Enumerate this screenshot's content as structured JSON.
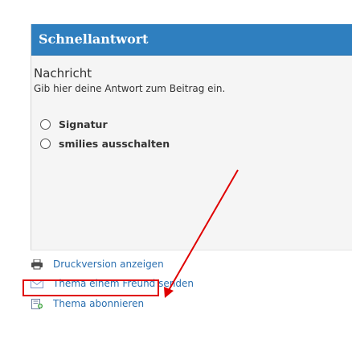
{
  "panel": {
    "title": "Schnellantwort",
    "section_title": "Nachricht",
    "section_desc": "Gib hier deine Antwort zum Beitrag ein.",
    "options": [
      {
        "label": "Signatur"
      },
      {
        "label": "smilies ausschalten"
      }
    ]
  },
  "links": {
    "print_label": "Druckversion anzeigen",
    "email_label": "Thema einem Freund senden",
    "subscribe_label": "Thema abonnieren"
  },
  "colors": {
    "header_bg": "#2f7fbf",
    "link": "#2a6fb0",
    "annotation": "#e00000"
  },
  "icons": {
    "print": "printer-icon",
    "email": "envelope-icon",
    "subscribe": "subscribe-icon"
  }
}
